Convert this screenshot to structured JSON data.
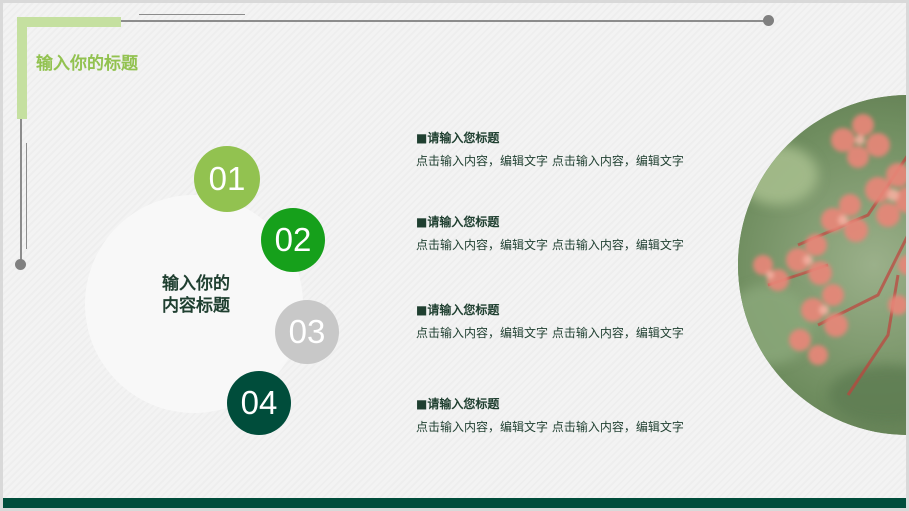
{
  "slide": {
    "title": "输入你的标题",
    "center_label_line1": "输入你的",
    "center_label_line2": "内容标题",
    "numbers": [
      "01",
      "02",
      "03",
      "04"
    ],
    "items": [
      {
        "title": "■请输入您标题",
        "desc": "点击输入内容，编辑文字 点击输入内容，编辑文字"
      },
      {
        "title": "■请输入您标题",
        "desc": "点击输入内容，编辑文字 点击输入内容，编辑文字"
      },
      {
        "title": "■请输入您标题",
        "desc": "点击输入内容，编辑文字 点击输入内容，编辑文字"
      },
      {
        "title": "■请输入您标题",
        "desc": "点击输入内容，编辑文字 点击输入内容，编辑文字"
      }
    ]
  },
  "colors": {
    "accent_light_green": "#92c250",
    "accent_green": "#16a01b",
    "accent_gray": "#c8c8c8",
    "accent_dark_green": "#004d3b",
    "corner_green": "#c5e0a0",
    "text_dark": "#1f3f30"
  }
}
